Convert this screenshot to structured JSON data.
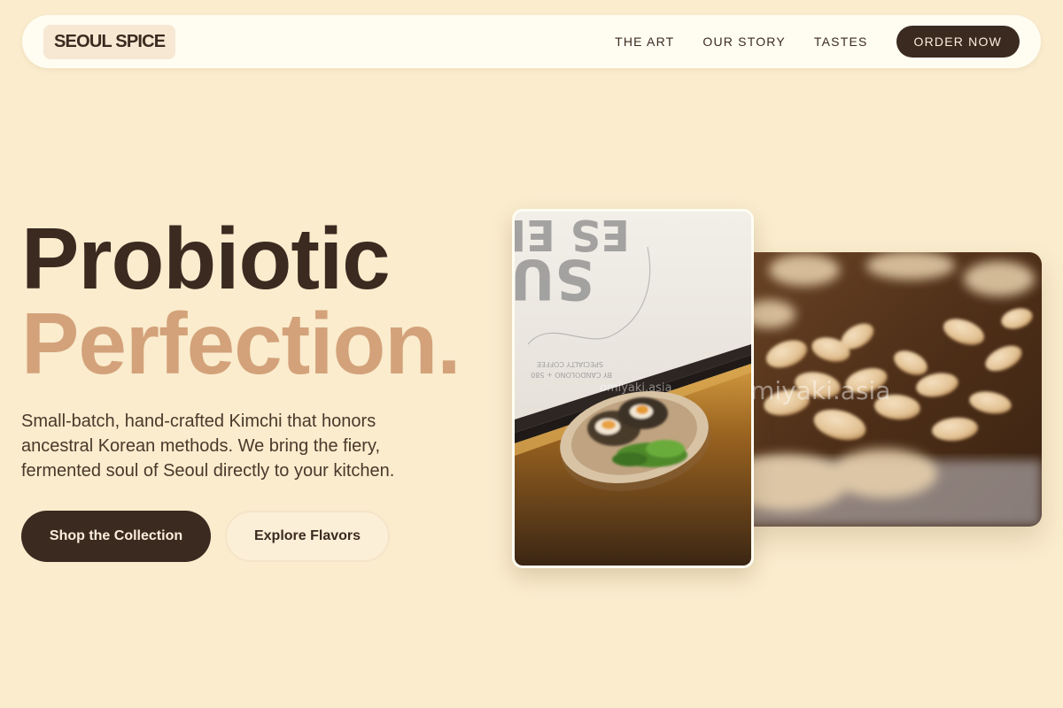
{
  "nav": {
    "logo": "SEOUL SPICE",
    "links": [
      "THE ART",
      "OUR STORY",
      "TASTES"
    ],
    "cta": "ORDER NOW"
  },
  "hero": {
    "title_line1": "Probiotic",
    "title_line2": "Perfection.",
    "description": "Small-batch, hand-crafted Kimchi that honors ancestral Korean methods. We bring the fiery, fermented soul of Seoul directly to your kitchen.",
    "primary_button": "Shop the Collection",
    "secondary_button": "Explore Flavors"
  },
  "images": {
    "front_sign_text": "ES EL SUR",
    "front_sign_sub1": "SPECIALTY COFFEE",
    "front_sign_sub2": "BY CANDOLONO + 580",
    "watermark_front": "omiyaki.asia",
    "watermark_back": "omiyaki.asia"
  },
  "colors": {
    "background": "#faeccd",
    "dark_brown": "#3b2a20",
    "accent_tan": "#d3a27a",
    "nav_bg": "#fffdf2"
  }
}
